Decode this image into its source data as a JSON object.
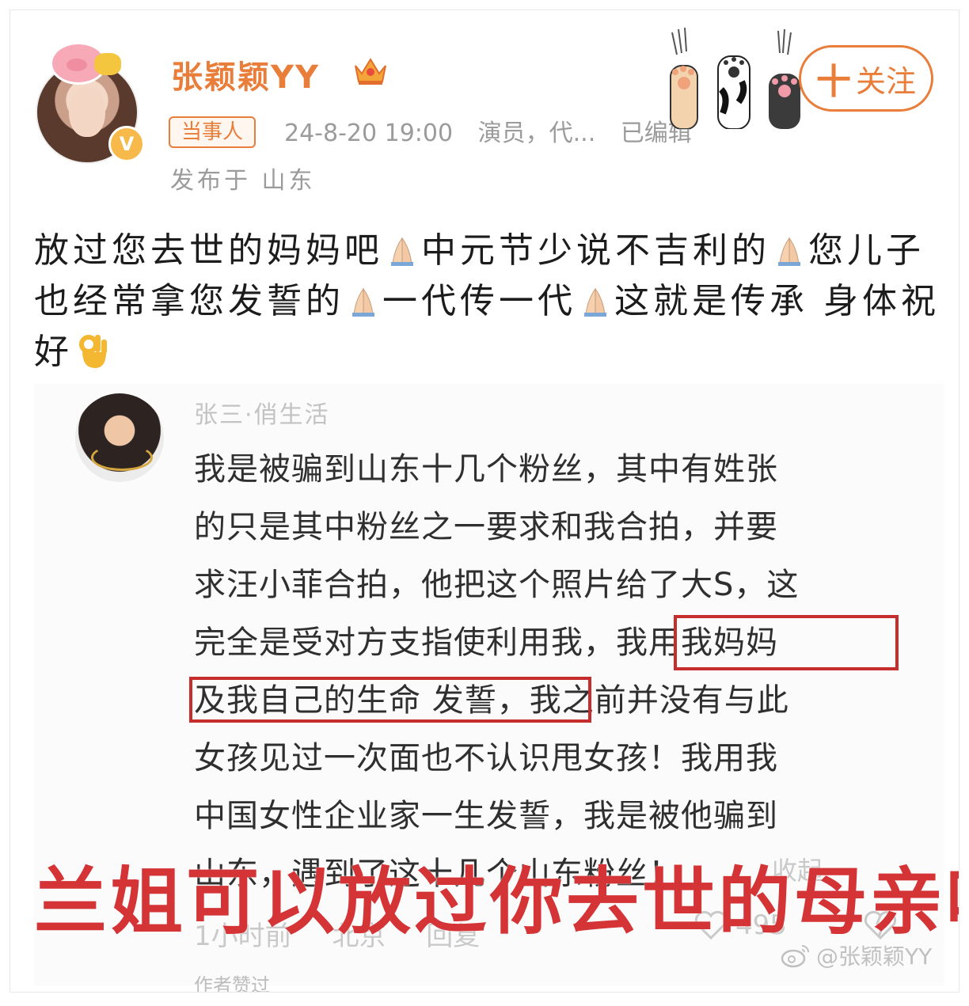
{
  "post": {
    "username": "张颖颖YY",
    "badge": "当事人",
    "datetime": "24-8-20 19:00",
    "source": "演员，代...",
    "edited": "已编辑",
    "location": "发布于 山东",
    "follow_plus": "十",
    "follow_label": "关注",
    "text_parts": [
      "放过您去世的妈妈吧",
      "中元节少说不吉利的",
      "您儿子也经常拿您发誓的",
      "一代传一代",
      "这就是传承 身体祝好"
    ]
  },
  "comment": {
    "name": "张三·俏生活",
    "lines": [
      "我是被骗到山东十几个粉丝，其中有姓张",
      "的只是其中粉丝之一要求和我合拍，并要",
      "求汪小菲合拍，他把这个照片给了大S，这",
      "完全是受对方支指使利用我，我用我妈妈",
      "及我自己的生命 发誓，我之前并没有与此",
      "女孩见过一次面也不认识甩女孩！我用我",
      "中国女性企业家一生发誓，我是被他骗到",
      "山东，遇到了这十几个山东粉丝！"
    ],
    "collapse": "收起",
    "time": "1小时前",
    "location": "北京",
    "reply": "回复",
    "likes": "495",
    "author_liked": "作者赞过"
  },
  "overlay_caption": "兰姐可以放过你去世的母亲吗",
  "watermark": "@张颖颖YY",
  "colors": {
    "accent": "#e97d3a",
    "highlight_box": "#c62d2d",
    "overlay_text": "#d43436",
    "meta_text": "#9b9b9b"
  },
  "icons": [
    "pig-sticker-icon",
    "verified-icon",
    "crown-icon",
    "cat-paws-icon",
    "pray-emoji-icon",
    "ok-hand-emoji-icon",
    "heart-icon",
    "broken-heart-icon",
    "weibo-logo-icon"
  ]
}
